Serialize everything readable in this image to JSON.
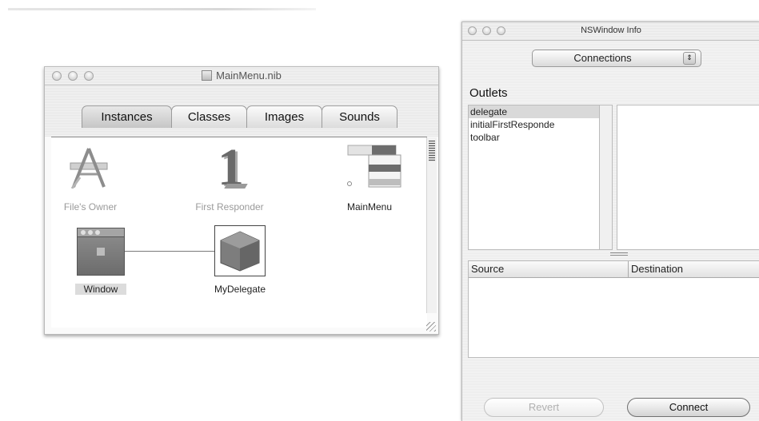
{
  "nib_window": {
    "title": "MainMenu.nib",
    "tabs": [
      {
        "label": "Instances",
        "active": true
      },
      {
        "label": "Classes",
        "active": false
      },
      {
        "label": "Images",
        "active": false
      },
      {
        "label": "Sounds",
        "active": false
      }
    ],
    "objects": {
      "files_owner": "File's Owner",
      "first_responder": "First Responder",
      "main_menu": "MainMenu",
      "window": "Window",
      "my_delegate": "MyDelegate"
    },
    "first_responder_glyph": "1"
  },
  "info_panel": {
    "title": "NSWindow Info",
    "popup_value": "Connections",
    "outlets_title": "Outlets",
    "outlets": [
      "delegate",
      "initialFirstResponde",
      "toolbar"
    ],
    "selected_outlet_index": 0,
    "columns": {
      "source": "Source",
      "destination": "Destination"
    },
    "buttons": {
      "revert": "Revert",
      "connect": "Connect"
    },
    "revert_enabled": false
  }
}
